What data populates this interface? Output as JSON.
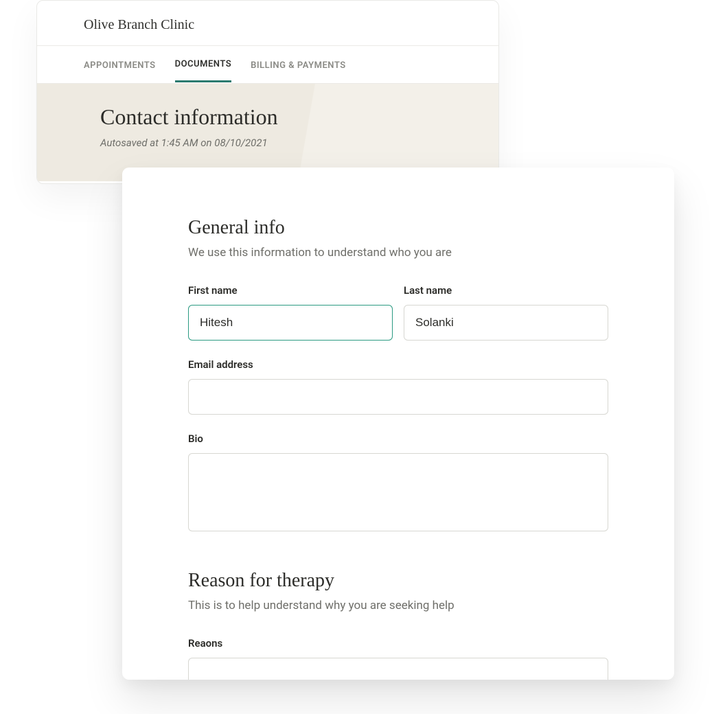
{
  "header": {
    "clinic_name": "Olive Branch Clinic"
  },
  "tabs": {
    "appointments": "APPOINTMENTS",
    "documents": "DOCUMENTS",
    "billing": "BILLING & PAYMENTS"
  },
  "banner": {
    "title": "Contact information",
    "autosave": "Autosaved at 1:45 AM on 08/10/2021"
  },
  "form": {
    "general": {
      "title": "General info",
      "subtitle": "We use this information to understand who you are",
      "first_name_label": "First name",
      "first_name_value": "Hitesh",
      "last_name_label": "Last name",
      "last_name_value": "Solanki",
      "email_label": "Email address",
      "email_value": "",
      "bio_label": "Bio",
      "bio_value": ""
    },
    "reason": {
      "title": "Reason for therapy",
      "subtitle": "This is to help understand why you are seeking help",
      "reasons_label": "Reaons",
      "reasons_value": ""
    }
  }
}
